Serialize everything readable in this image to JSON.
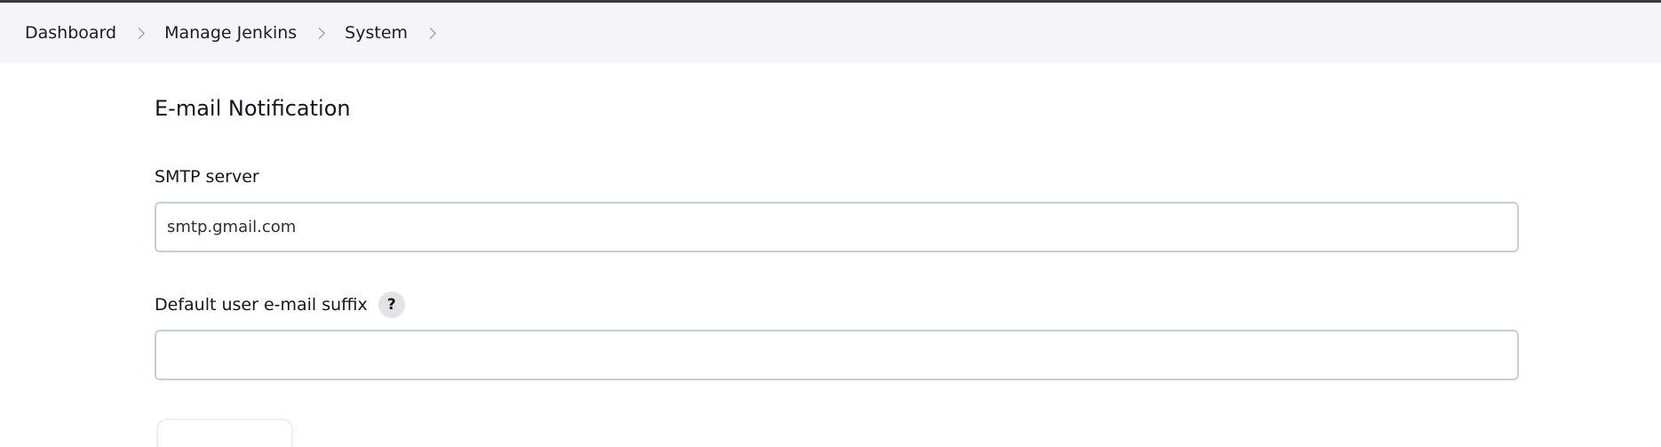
{
  "breadcrumb": {
    "items": [
      {
        "label": "Dashboard"
      },
      {
        "label": "Manage Jenkins"
      },
      {
        "label": "System"
      }
    ]
  },
  "section": {
    "title": "E-mail Notification"
  },
  "fields": {
    "smtp_server": {
      "label": "SMTP server",
      "value": "smtp.gmail.com"
    },
    "default_suffix": {
      "label": "Default user e-mail suffix",
      "help_icon_text": "?",
      "value": ""
    }
  },
  "icons": {
    "breadcrumb_separator": "chevron-right-icon",
    "help": "help-icon"
  },
  "colors": {
    "breadcrumb_bg": "#f5f5f7",
    "input_border": "#c8cdd3",
    "help_bg": "#e3e3e6"
  }
}
